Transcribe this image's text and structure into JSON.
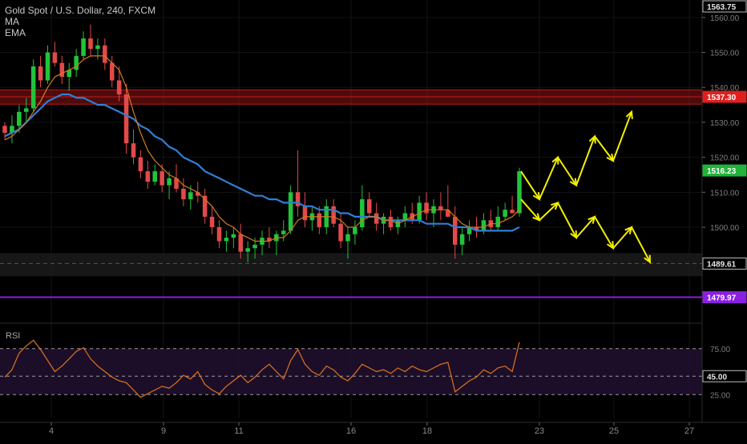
{
  "legend": {
    "title": "Gold Spot / U.S. Dollar, 240, FXCM",
    "ma": "MA",
    "ema": "EMA"
  },
  "rsi_label": "RSI",
  "colors": {
    "background": "#000000",
    "up": "#22c33a",
    "down": "#e24a4a",
    "ma": "#d47a1f",
    "ema": "#2f7fd8",
    "arrows": "#f3f000",
    "resistance_zone": "#b01818",
    "support_line": "#8a1fe0",
    "rsi_line": "#e0731a",
    "rsi_band": "#1f0f2d",
    "price_tag_red": "#e02020",
    "price_tag_green": "#22b33a",
    "price_tag_purple": "#8a1fe0"
  },
  "price_tags": [
    {
      "label": "1563.75",
      "value": 1563.75,
      "style": "plain"
    },
    {
      "label": "1537.30",
      "value": 1537.3,
      "style": "red"
    },
    {
      "label": "1516.23",
      "value": 1516.23,
      "style": "green"
    },
    {
      "label": "1489.61",
      "value": 1489.61,
      "style": "plain"
    },
    {
      "label": "1479.97",
      "value": 1479.97,
      "style": "purple"
    }
  ],
  "rsi_tags": [
    {
      "label": "45.00",
      "value": 45,
      "style": "plain"
    }
  ],
  "chart_data": {
    "type": "candlestick",
    "title": "Gold Spot / U.S. Dollar, 240, FXCM",
    "price_axis": {
      "min": 1473.0,
      "max": 1565.0,
      "ticks": [
        1500,
        1510,
        1520,
        1530,
        1540,
        1550,
        1560
      ],
      "labels": [
        "1500.00",
        "1510.00",
        "1520.00",
        "1530.00",
        "1540.00",
        "1550.00",
        "1560.00"
      ]
    },
    "rsi_axis": {
      "min": 0,
      "max": 100,
      "ticks": [
        25,
        45,
        75
      ],
      "labels": [
        "25.00",
        "45.00",
        "75.00"
      ],
      "band": [
        25,
        75
      ]
    },
    "time_axis": {
      "labels": [
        {
          "label": "4",
          "day": 4
        },
        {
          "label": "9",
          "day": 9
        },
        {
          "label": "11",
          "day": 11
        },
        {
          "label": "16",
          "day": 16
        },
        {
          "label": "18",
          "day": 18
        },
        {
          "label": "23",
          "day": 23
        },
        {
          "label": "25",
          "day": 25
        },
        {
          "label": "27",
          "day": 27
        }
      ]
    },
    "resistance_zone": [
      1535.2,
      1539.3
    ],
    "resistance_line": 1537.3,
    "support_zone": [
      1486.0,
      1492.6
    ],
    "support_line": 1489.61,
    "horizontal_line": 1479.97,
    "last_price": 1516.23,
    "rsi_level": 45.0,
    "ma_label": "MA",
    "ema_label": "EMA",
    "rsi_label": "RSI",
    "candles": [
      [
        1529,
        1530,
        1525,
        1527
      ],
      [
        1527,
        1532,
        1524,
        1529
      ],
      [
        1529,
        1535,
        1527,
        1533
      ],
      [
        1533,
        1537,
        1530,
        1534
      ],
      [
        1534,
        1548,
        1533,
        1546
      ],
      [
        1546,
        1549,
        1540,
        1542
      ],
      [
        1542,
        1552,
        1541,
        1550
      ],
      [
        1550,
        1553,
        1546,
        1547
      ],
      [
        1547,
        1549,
        1541,
        1543
      ],
      [
        1543,
        1547,
        1539,
        1545
      ],
      [
        1545,
        1551,
        1543,
        1549
      ],
      [
        1549,
        1556,
        1548,
        1554
      ],
      [
        1554,
        1558,
        1549,
        1551
      ],
      [
        1551,
        1554,
        1548,
        1552
      ],
      [
        1552,
        1554,
        1545,
        1547
      ],
      [
        1547,
        1549,
        1540,
        1542
      ],
      [
        1542,
        1546,
        1536,
        1538
      ],
      [
        1538,
        1541,
        1521,
        1524
      ],
      [
        1524,
        1528,
        1518,
        1520
      ],
      [
        1520,
        1522,
        1514,
        1516
      ],
      [
        1516,
        1519,
        1511,
        1513
      ],
      [
        1513,
        1518,
        1512,
        1516
      ],
      [
        1516,
        1518,
        1510,
        1512
      ],
      [
        1512,
        1516,
        1508,
        1514
      ],
      [
        1514,
        1518,
        1510,
        1511
      ],
      [
        1511,
        1514,
        1506,
        1508
      ],
      [
        1508,
        1512,
        1505,
        1510
      ],
      [
        1510,
        1513,
        1507,
        1509
      ],
      [
        1509,
        1511,
        1501,
        1503
      ],
      [
        1503,
        1506,
        1498,
        1500
      ],
      [
        1500,
        1502,
        1494,
        1496
      ],
      [
        1496,
        1499,
        1493,
        1497
      ],
      [
        1497,
        1500,
        1494,
        1498
      ],
      [
        1498,
        1501,
        1491,
        1493
      ],
      [
        1493,
        1496,
        1490,
        1494
      ],
      [
        1494,
        1497,
        1491,
        1495
      ],
      [
        1495,
        1499,
        1492,
        1497
      ],
      [
        1497,
        1500,
        1494,
        1496
      ],
      [
        1496,
        1499,
        1492,
        1498
      ],
      [
        1498,
        1502,
        1496,
        1499
      ],
      [
        1499,
        1512,
        1498,
        1510
      ],
      [
        1510,
        1522,
        1503,
        1506
      ],
      [
        1506,
        1510,
        1500,
        1502
      ],
      [
        1502,
        1506,
        1499,
        1504
      ],
      [
        1504,
        1506,
        1498,
        1500
      ],
      [
        1500,
        1508,
        1498,
        1506
      ],
      [
        1506,
        1508,
        1500,
        1501
      ],
      [
        1501,
        1504,
        1494,
        1496
      ],
      [
        1496,
        1500,
        1491,
        1498
      ],
      [
        1498,
        1502,
        1495,
        1500
      ],
      [
        1500,
        1512,
        1499,
        1508
      ],
      [
        1508,
        1510,
        1503,
        1504
      ],
      [
        1504,
        1507,
        1499,
        1501
      ],
      [
        1501,
        1504,
        1498,
        1503
      ],
      [
        1503,
        1505,
        1499,
        1500
      ],
      [
        1500,
        1503,
        1498,
        1502
      ],
      [
        1502,
        1506,
        1500,
        1504
      ],
      [
        1504,
        1507,
        1501,
        1502
      ],
      [
        1502,
        1509,
        1501,
        1507
      ],
      [
        1507,
        1510,
        1502,
        1504
      ],
      [
        1504,
        1508,
        1500,
        1506
      ],
      [
        1506,
        1510,
        1502,
        1505
      ],
      [
        1505,
        1512,
        1503,
        1503
      ],
      [
        1503,
        1506,
        1491,
        1495
      ],
      [
        1495,
        1500,
        1492,
        1498
      ],
      [
        1498,
        1502,
        1496,
        1500
      ],
      [
        1500,
        1503,
        1497,
        1499
      ],
      [
        1499,
        1504,
        1498,
        1502
      ],
      [
        1502,
        1505,
        1499,
        1500
      ],
      [
        1500,
        1506,
        1499,
        1503
      ],
      [
        1503,
        1507,
        1502,
        1505
      ],
      [
        1505,
        1509,
        1504,
        1504
      ],
      [
        1504,
        1517,
        1503,
        1516
      ]
    ],
    "ma_values": [
      1525,
      1526,
      1528,
      1530,
      1533,
      1536,
      1540,
      1543,
      1544,
      1545,
      1546,
      1548,
      1549,
      1549,
      1549,
      1547,
      1545,
      1540,
      1533,
      1527,
      1522,
      1519,
      1517,
      1515,
      1514,
      1512,
      1511,
      1510,
      1508,
      1506,
      1503,
      1501,
      1500,
      1498,
      1497,
      1496,
      1496,
      1496,
      1497,
      1497,
      1499,
      1502,
      1503,
      1503,
      1503,
      1503,
      1503,
      1502,
      1500,
      1500,
      1502,
      1503,
      1503,
      1502,
      1502,
      1501,
      1502,
      1503,
      1504,
      1505,
      1505,
      1505,
      1505,
      1503,
      1501,
      1500,
      1500,
      1500,
      1501,
      1501,
      1502,
      1503,
      1505
    ],
    "ema_values": [
      1526,
      1527,
      1528,
      1530,
      1532,
      1534,
      1536,
      1537,
      1538,
      1538,
      1537,
      1537,
      1536,
      1535,
      1535,
      1534,
      1533,
      1532,
      1531,
      1529,
      1528,
      1526,
      1525,
      1523,
      1522,
      1520,
      1519,
      1518,
      1516,
      1515,
      1514,
      1513,
      1512,
      1511,
      1510,
      1509,
      1509,
      1508,
      1508,
      1507,
      1507,
      1507,
      1506,
      1506,
      1505,
      1505,
      1505,
      1504,
      1504,
      1503,
      1503,
      1503,
      1503,
      1502,
      1502,
      1502,
      1502,
      1502,
      1502,
      1501,
      1501,
      1501,
      1501,
      1500,
      1500,
      1500,
      1499,
      1499,
      1499,
      1499,
      1499,
      1499,
      1500
    ],
    "rsi_values": [
      44,
      52,
      70,
      78,
      84,
      74,
      62,
      50,
      56,
      64,
      72,
      76,
      64,
      56,
      50,
      44,
      40,
      38,
      30,
      22,
      26,
      30,
      34,
      32,
      38,
      46,
      42,
      50,
      36,
      30,
      26,
      34,
      40,
      46,
      38,
      44,
      52,
      58,
      50,
      42,
      62,
      74,
      58,
      50,
      46,
      56,
      52,
      44,
      40,
      48,
      58,
      54,
      50,
      52,
      48,
      54,
      50,
      56,
      52,
      50,
      54,
      58,
      60,
      28,
      34,
      40,
      44,
      52,
      48,
      54,
      56,
      50,
      82
    ],
    "projection_up": [
      [
        1516,
        0
      ],
      [
        1508,
        1
      ],
      [
        1520,
        2
      ],
      [
        1512,
        3
      ],
      [
        1526,
        4
      ],
      [
        1519,
        5
      ],
      [
        1533,
        6
      ]
    ],
    "projection_down": [
      [
        1508,
        0
      ],
      [
        1502,
        1
      ],
      [
        1507,
        2
      ],
      [
        1497,
        3
      ],
      [
        1503,
        4
      ],
      [
        1494,
        5
      ],
      [
        1500,
        6
      ],
      [
        1490,
        7
      ]
    ]
  }
}
